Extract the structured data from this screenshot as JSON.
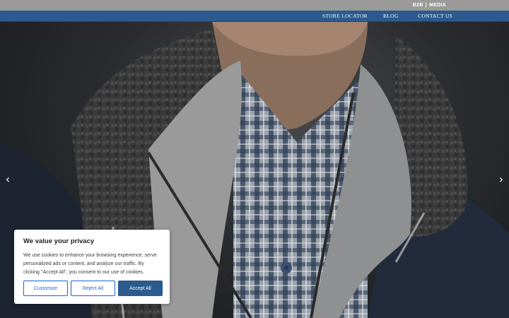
{
  "topbar": {
    "b2b": "B2B",
    "separator": "|",
    "media": "MEDIA"
  },
  "nav": {
    "store_locator": "STORE LOCATOR",
    "blog": "BLOG",
    "contact_us": "CONTACT US"
  },
  "hero": {
    "prev_arrow": "‹",
    "next_arrow": "›",
    "prev_icon": "chevron-left-icon",
    "next_icon": "chevron-right-icon"
  },
  "cookie_banner": {
    "title": "We value your privacy",
    "body": "We use cookies to enhance your browsing experience, serve personalized ads or content, and analyze our traffic. By clicking \"Accept All\", you consent to our use of cookies.",
    "customize_label": "Customize",
    "reject_label": "Reject All",
    "accept_label": "Accept All"
  },
  "colors": {
    "nav_blue": "#2b5a8e",
    "topbar_gray": "#9a9a99",
    "button_outline": "#1863dc"
  }
}
